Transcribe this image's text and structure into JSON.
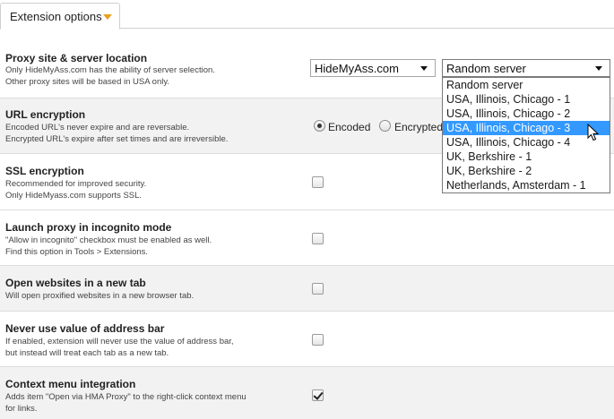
{
  "tab": {
    "label": "Extension options"
  },
  "proxy": {
    "title": "Proxy site & server location",
    "desc1": "Only HideMyAss.com has the ability of server selection.",
    "desc2": "Other proxy sites will be based in USA only.",
    "site_select": "HideMyAss.com",
    "server_select": "Random server",
    "server_options": [
      "Random server",
      "USA, Illinois, Chicago - 1",
      "USA, Illinois, Chicago - 2",
      "USA, Illinois, Chicago - 3",
      "USA, Illinois, Chicago - 4",
      "UK, Berkshire - 1",
      "UK, Berkshire - 2",
      "Netherlands, Amsterdam - 1"
    ],
    "highlighted_option": "USA, Illinois, Chicago - 3"
  },
  "url_encryption": {
    "title": "URL encryption",
    "desc1": "Encoded URL's never expire and are reversable.",
    "desc2": "Encrypted URL's expire after set times and are irreversible.",
    "option_encoded": "Encoded",
    "option_encrypted": "Encrypted",
    "selected": "Encoded"
  },
  "ssl": {
    "title": "SSL encryption",
    "desc1": "Recommended for improved security.",
    "desc2": "Only HideMyass.com supports SSL.",
    "checked": false
  },
  "incognito": {
    "title": "Launch proxy in incognito mode",
    "desc1": "\"Allow in incognito\" checkbox must be enabled as well.",
    "desc2": "Find this option in Tools > Extensions.",
    "checked": false
  },
  "new_tab": {
    "title": "Open websites in a new tab",
    "desc1": "Will open proxified websites in a new browser tab.",
    "checked": false
  },
  "address_bar": {
    "title": "Never use value of address bar",
    "desc1": "If enabled, extension will never use the value of address bar,",
    "desc2": "but instead will treat each tab as a new tab.",
    "checked": false
  },
  "context_menu": {
    "title": "Context menu integration",
    "desc1": "Adds item \"Open via HMA Proxy\" to the right-click context menu",
    "desc2": "for links.",
    "checked": true
  },
  "colors": {
    "accent_arrow": "#e8a21a",
    "highlight": "#3399ff",
    "row_alt": "#f2f2f2"
  }
}
